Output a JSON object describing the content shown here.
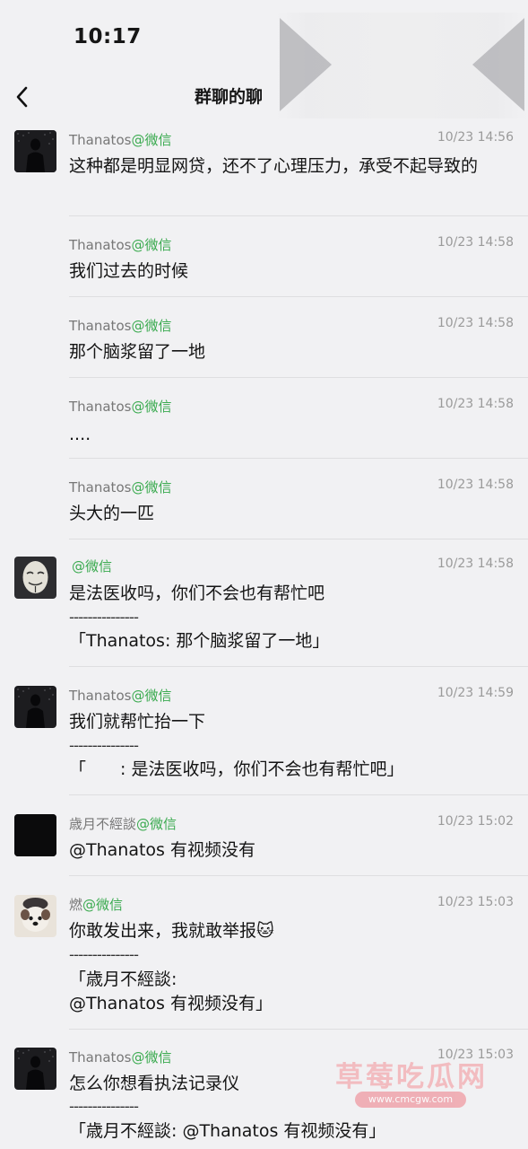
{
  "status_bar": {
    "time": "10:17"
  },
  "nav": {
    "title": "群聊的聊"
  },
  "source_label": "@微信",
  "messages": [
    {
      "sender": "Thanatos",
      "time": "10/23 14:56",
      "text": "这种都是明显网贷，还不了心理压力，承受不起导致的",
      "avatar": "dark-figure"
    },
    {
      "sender": "Thanatos",
      "time": "10/23 14:58",
      "text": "我们过去的时候"
    },
    {
      "sender": "Thanatos",
      "time": "10/23 14:58",
      "text": "那个脑浆留了一地"
    },
    {
      "sender": "Thanatos",
      "time": "10/23 14:58",
      "text": "...."
    },
    {
      "sender": "Thanatos",
      "time": "10/23 14:58",
      "text": "头大的一匹"
    },
    {
      "sender": "",
      "time": "10/23 14:58",
      "text": "是法医收吗，你们不会也有帮忙吧",
      "rule": "---------------",
      "quote": [
        "「Thanatos: 那个脑浆留了一地」"
      ],
      "avatar": "mask"
    },
    {
      "sender": "Thanatos",
      "time": "10/23 14:59",
      "text": "我们就帮忙抬一下",
      "rule": "---------------",
      "quote": [
        "「　　: 是法医收吗，你们不会也有帮忙吧」"
      ],
      "avatar": "dark-figure"
    },
    {
      "sender": "歳月不經談",
      "time": "10/23 15:02",
      "text": "@Thanatos 有视频没有",
      "avatar": "black"
    },
    {
      "sender": "燃",
      "time": "10/23 15:03",
      "text": "你敢发出来，我就敢举报",
      "emoji": "🐱",
      "rule": "---------------",
      "quote": [
        "「歳月不經談:",
        "@Thanatos 有视频没有」"
      ],
      "avatar": "puppy"
    },
    {
      "sender": "Thanatos",
      "time": "10/23 15:03",
      "text": "怎么你想看执法记录仪",
      "rule": "---------------",
      "quote": [
        "「歳月不經談: @Thanatos 有视频没有」"
      ],
      "avatar": "dark-figure"
    }
  ],
  "watermark": {
    "main": "草莓吃瓜网",
    "sub": "www.cmcgw.com"
  },
  "colors": {
    "background": "#f1f1f3",
    "source_green": "#3aaa4f",
    "meta_gray": "#777777"
  }
}
